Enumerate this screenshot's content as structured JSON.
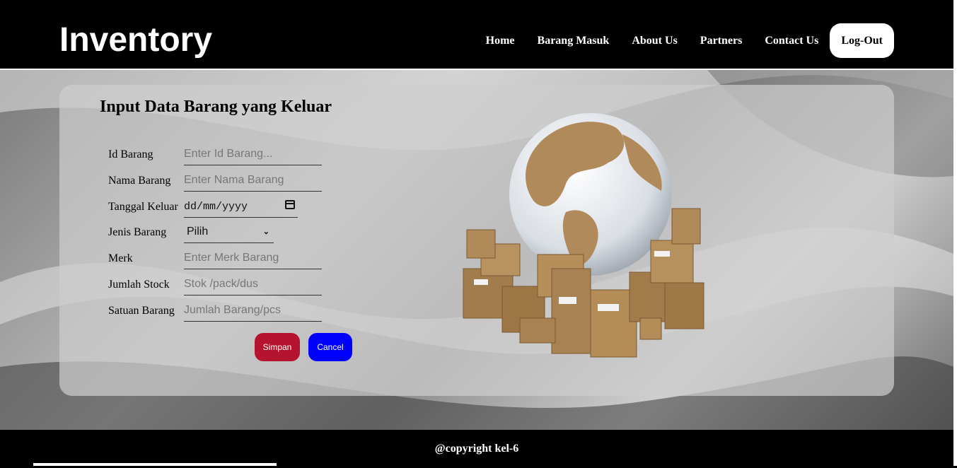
{
  "header": {
    "logo": "Inventory",
    "nav": [
      "Home",
      "Barang Masuk",
      "About Us",
      "Partners",
      "Contact Us"
    ],
    "logout": "Log-Out"
  },
  "form": {
    "title": "Input Data Barang yang Keluar",
    "fields": [
      {
        "label": "Id Barang",
        "placeholder": "Enter Id Barang..."
      },
      {
        "label": "Nama Barang",
        "placeholder": "Enter Nama Barang"
      },
      {
        "label": "Tanggal Keluar",
        "value": "dd/mm/yyyy"
      },
      {
        "label": "Jenis Barang",
        "value": "Pilih"
      },
      {
        "label": "Merk",
        "placeholder": "Enter Merk Barang"
      },
      {
        "label": "Jumlah Stock",
        "placeholder": "Stok /pack/dus"
      },
      {
        "label": "Satuan Barang",
        "placeholder": "Jumlah Barang/pcs"
      }
    ],
    "save_label": "Simpan",
    "cancel_label": "Cancel"
  },
  "footer": {
    "text": "@copyright kel-6"
  },
  "colors": {
    "save": "#b5142e",
    "cancel": "#0000ff",
    "header_bg": "#000000"
  },
  "icons": {
    "date": "calendar-icon",
    "select": "chevron-down-icon",
    "illustration": "globe-boxes-image"
  }
}
